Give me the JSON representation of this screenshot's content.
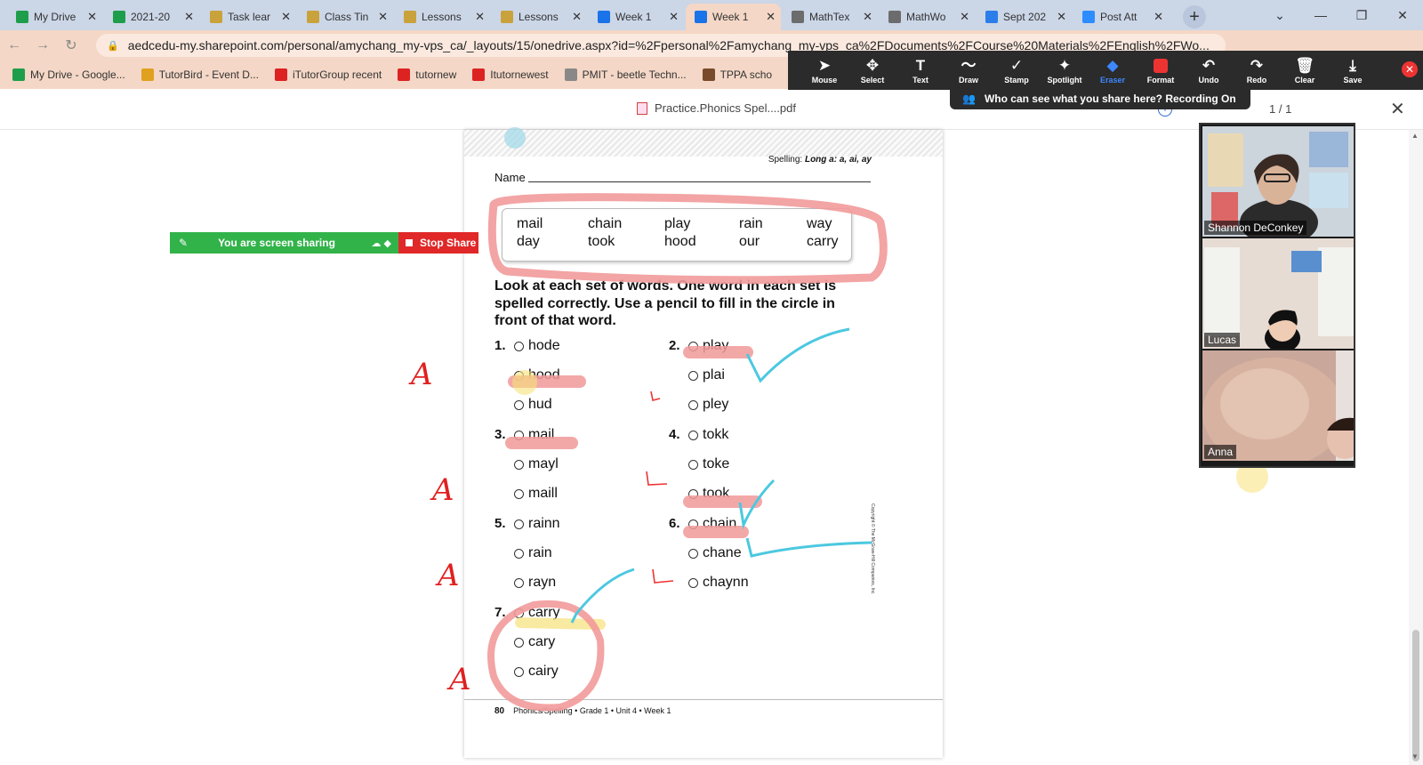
{
  "browser": {
    "tabs": [
      {
        "label": "My Drive",
        "icon": "google-drive-icon",
        "color": "#1e9e4a",
        "active": false
      },
      {
        "label": "2021-20",
        "icon": "google-sheets-icon",
        "color": "#1e9e4a",
        "active": false
      },
      {
        "label": "Task lear",
        "icon": "document-icon",
        "color": "#c9a23b",
        "active": false
      },
      {
        "label": "Class Tin",
        "icon": "document-icon",
        "color": "#c9a23b",
        "active": false
      },
      {
        "label": "Lessons",
        "icon": "document-icon",
        "color": "#c9a23b",
        "active": false
      },
      {
        "label": "Lessons",
        "icon": "document-icon",
        "color": "#c9a23b",
        "active": false
      },
      {
        "label": "Week 1",
        "icon": "onedrive-icon",
        "color": "#1a73e8",
        "active": false
      },
      {
        "label": "Week 1",
        "icon": "onedrive-icon",
        "color": "#1a73e8",
        "active": true
      },
      {
        "label": "MathTex",
        "icon": "globe-icon",
        "color": "#6c6c6c",
        "active": false
      },
      {
        "label": "MathWo",
        "icon": "globe-icon",
        "color": "#6c6c6c",
        "active": false
      },
      {
        "label": "Sept 202",
        "icon": "google-docs-icon",
        "color": "#2b7de9",
        "active": false
      },
      {
        "label": "Post Att",
        "icon": "zoom-icon",
        "color": "#2d8cff",
        "active": false
      }
    ],
    "new_tab": "+",
    "url": "aedcedu-my.sharepoint.com/personal/amychang_my-vps_ca/_layouts/15/onedrive.aspx?id=%2Fpersonal%2Famychang_my-vps_ca%2FDocuments%2FCourse%20Materials%2FEnglish%2FWo...",
    "bookmarks": [
      {
        "label": "My Drive - Google...",
        "color": "#1e9e4a"
      },
      {
        "label": "TutorBird - Event D...",
        "color": "#e0a020"
      },
      {
        "label": "iTutorGroup recent",
        "color": "#d22"
      },
      {
        "label": "tutornew",
        "color": "#d22"
      },
      {
        "label": "Itutornewest",
        "color": "#d22"
      },
      {
        "label": "PMIT - beetle Techn...",
        "color": "#888"
      },
      {
        "label": "TPPA scho",
        "color": "#7a4b2a"
      }
    ]
  },
  "pdf_viewer": {
    "filename": "Practice.Phonics Spel....pdf",
    "page_count": "1 / 1",
    "close": "✕"
  },
  "zoom_toolbar": {
    "buttons": [
      {
        "label": "Mouse",
        "icon": "mouse-pointer-icon",
        "glyph": "➤"
      },
      {
        "label": "Select",
        "icon": "move-arrows-icon",
        "glyph": "✥"
      },
      {
        "label": "Text",
        "icon": "text-icon",
        "glyph": "T"
      },
      {
        "label": "Draw",
        "icon": "draw-squiggle-icon",
        "glyph": "〜"
      },
      {
        "label": "Stamp",
        "icon": "stamp-check-icon",
        "glyph": "✓"
      },
      {
        "label": "Spotlight",
        "icon": "spotlight-icon",
        "glyph": "✦"
      },
      {
        "label": "Eraser",
        "icon": "eraser-icon",
        "glyph": "◆"
      },
      {
        "label": "Format",
        "icon": "format-color-icon",
        "glyph": ""
      },
      {
        "label": "Undo",
        "icon": "undo-icon",
        "glyph": "↶"
      },
      {
        "label": "Redo",
        "icon": "redo-icon",
        "glyph": "↷"
      },
      {
        "label": "Clear",
        "icon": "trash-icon",
        "glyph": "🗑"
      },
      {
        "label": "Save",
        "icon": "save-icon",
        "glyph": "⤓"
      }
    ],
    "recording_notice": "Who can see what you share here? Recording On"
  },
  "screen_share": {
    "status": "You are screen sharing",
    "stop_label": "Stop Share"
  },
  "worksheet": {
    "header": "Spelling: Long a: a, ai, ay",
    "header_prefix": "Spelling: ",
    "header_topic": "Long a: a, ai, ay",
    "name_label": "Name",
    "word_bank_row1": [
      "mail",
      "chain",
      "play",
      "rain",
      "way"
    ],
    "word_bank_row2": [
      "day",
      "took",
      "hood",
      "our",
      "carry"
    ],
    "instructions": "Look at each set of words. One word in each set is spelled correctly. Use a pencil to fill in the circle in front of that word.",
    "questions": [
      {
        "num": "1.",
        "options": [
          "hode",
          "hood",
          "hud"
        ]
      },
      {
        "num": "2.",
        "options": [
          "play",
          "plai",
          "pley"
        ]
      },
      {
        "num": "3.",
        "options": [
          "mail",
          "mayl",
          "maill"
        ]
      },
      {
        "num": "4.",
        "options": [
          "tokk",
          "toke",
          "took"
        ]
      },
      {
        "num": "5.",
        "options": [
          "rainn",
          "rain",
          "rayn"
        ]
      },
      {
        "num": "6.",
        "options": [
          "chain",
          "chane",
          "chaynn"
        ]
      },
      {
        "num": "7.",
        "options": [
          "carry",
          "cary",
          "cairy"
        ]
      }
    ],
    "footer_page": "80",
    "footer_text": "Phonics/Spelling • Grade 1 • Unit 4 • Week 1",
    "copyright": "Copyright © The McGraw-Hill Companies, Inc."
  },
  "participants": [
    {
      "name": "Shannon DeConkey"
    },
    {
      "name": "Lucas"
    },
    {
      "name": "Anna"
    }
  ],
  "annotation_marks": [
    "A",
    "A",
    "A",
    "A"
  ],
  "colors": {
    "annotation_red_highlight": "#f29a9a",
    "annotation_yellow": "#f7e27a",
    "annotation_cyan": "#4cc8e0",
    "zoom_toolbar_bg": "#2b2b2b",
    "share_green": "#32b34a",
    "share_red": "#e02828"
  }
}
